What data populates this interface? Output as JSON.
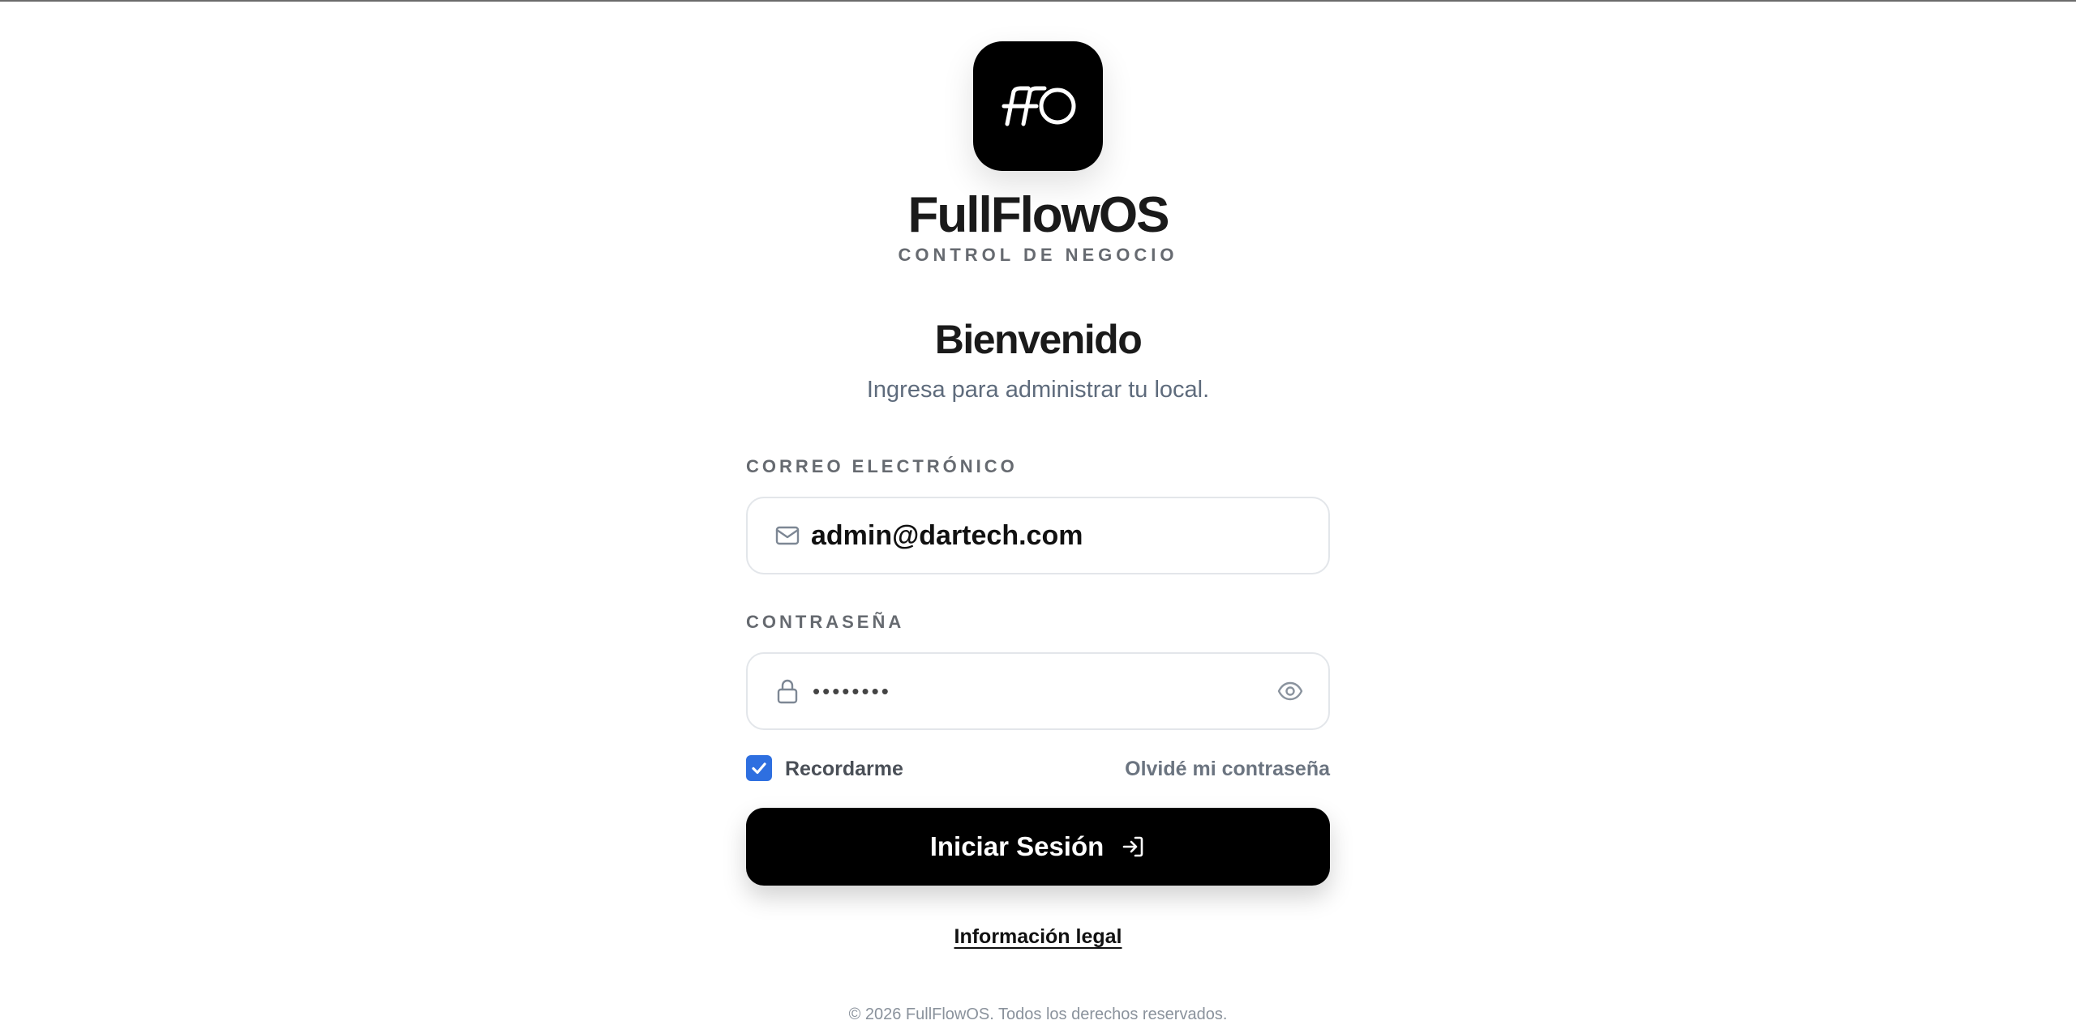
{
  "brand": {
    "logo_mark": "FFO",
    "name": "FullFlowOS",
    "tagline": "CONTROL DE NEGOCIO"
  },
  "welcome": {
    "title": "Bienvenido",
    "subtitle": "Ingresa para administrar tu local."
  },
  "form": {
    "email": {
      "label": "CORREO ELECTRÓNICO",
      "value": "admin@dartech.com",
      "icon": "mail-icon"
    },
    "password": {
      "label": "CONTRASEÑA",
      "masked_value": "••••••••",
      "icon": "lock-icon",
      "toggle_icon": "eye-icon"
    },
    "remember": {
      "label": "Recordarme",
      "checked": true
    },
    "forgot_label": "Olvidé mi contraseña",
    "submit_label": "Iniciar Sesión",
    "submit_icon": "sign-in-icon"
  },
  "legal_label": "Información legal",
  "footer_text": "© 2026 FullFlowOS. Todos los derechos reservados.",
  "colors": {
    "accent": "#2e6fe0",
    "primary_button": "#000000",
    "text": "#1a1a1a",
    "muted": "#5e6b7c"
  }
}
